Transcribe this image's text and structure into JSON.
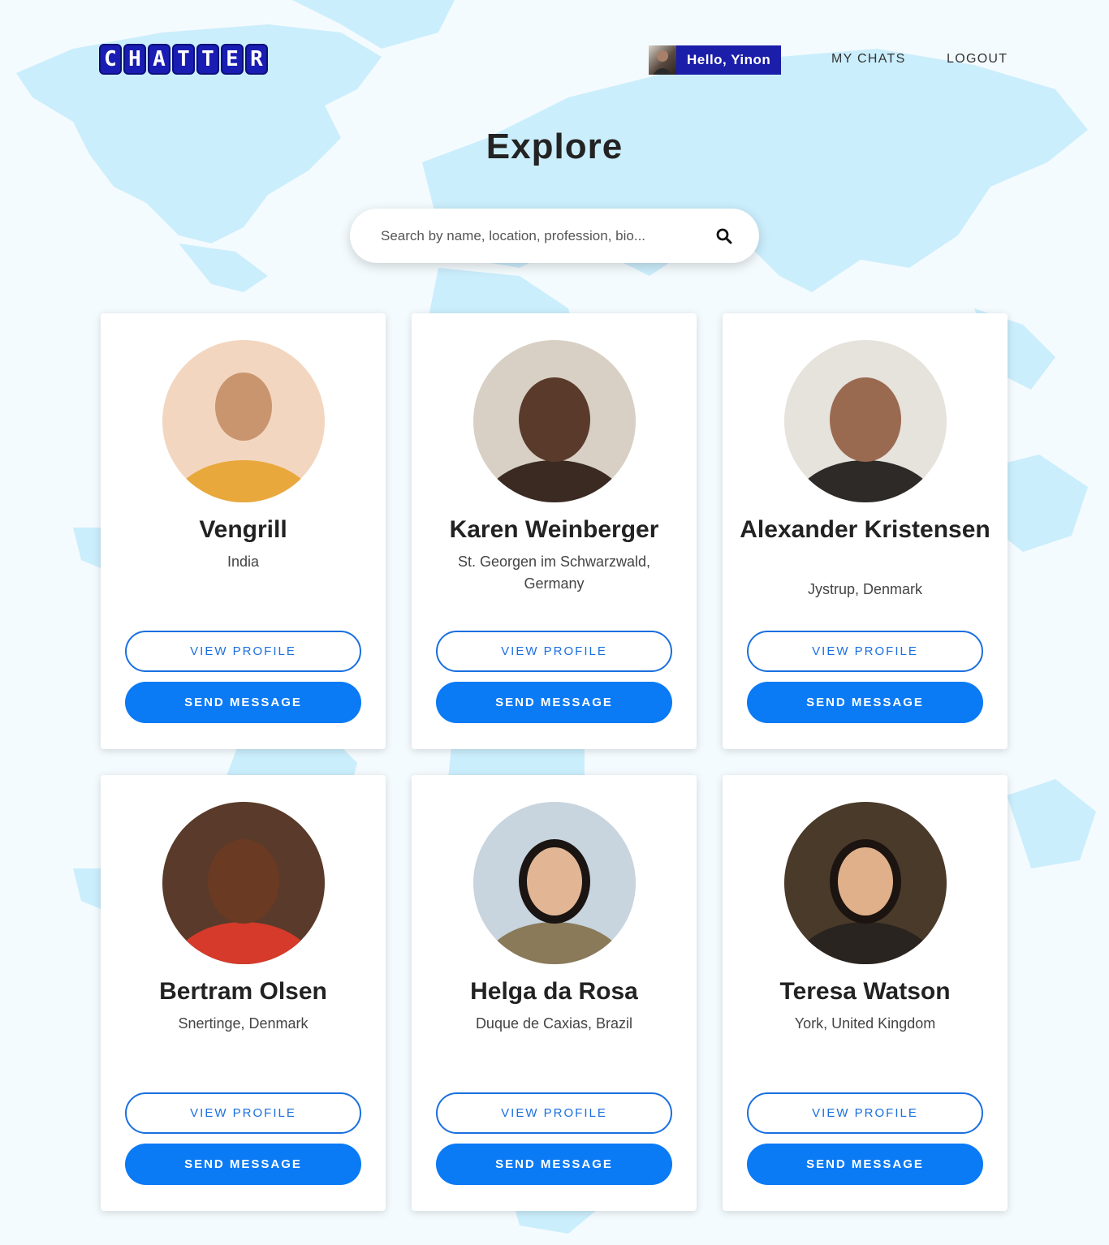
{
  "header": {
    "logo_letters": [
      "C",
      "H",
      "A",
      "T",
      "T",
      "E",
      "R"
    ],
    "greeting": "Hello, Yinon",
    "nav": {
      "my_chats": "MY CHATS",
      "logout": "LOGOUT"
    }
  },
  "page": {
    "title": "Explore",
    "search_placeholder": "Search by name, location, profession, bio..."
  },
  "card_labels": {
    "view_profile": "VIEW PROFILE",
    "send_message": "SEND MESSAGE"
  },
  "profiles": [
    {
      "name": "Vengrill",
      "location": "India"
    },
    {
      "name": "Karen Weinberger",
      "location": "St. Georgen im Schwarzwald, Germany"
    },
    {
      "name": "Alexander Kristensen",
      "location": "Jystrup, Denmark"
    },
    {
      "name": "Bertram Olsen",
      "location": "Snertinge, Denmark"
    },
    {
      "name": "Helga da Rosa",
      "location": "Duque de Caxias, Brazil"
    },
    {
      "name": "Teresa Watson",
      "location": "York, United Kingdom"
    }
  ],
  "colors": {
    "brand": "#1b1ea8",
    "primary_button": "#0a7af5",
    "outline_button": "#1a6fe0",
    "map": "#c9ecfb"
  }
}
